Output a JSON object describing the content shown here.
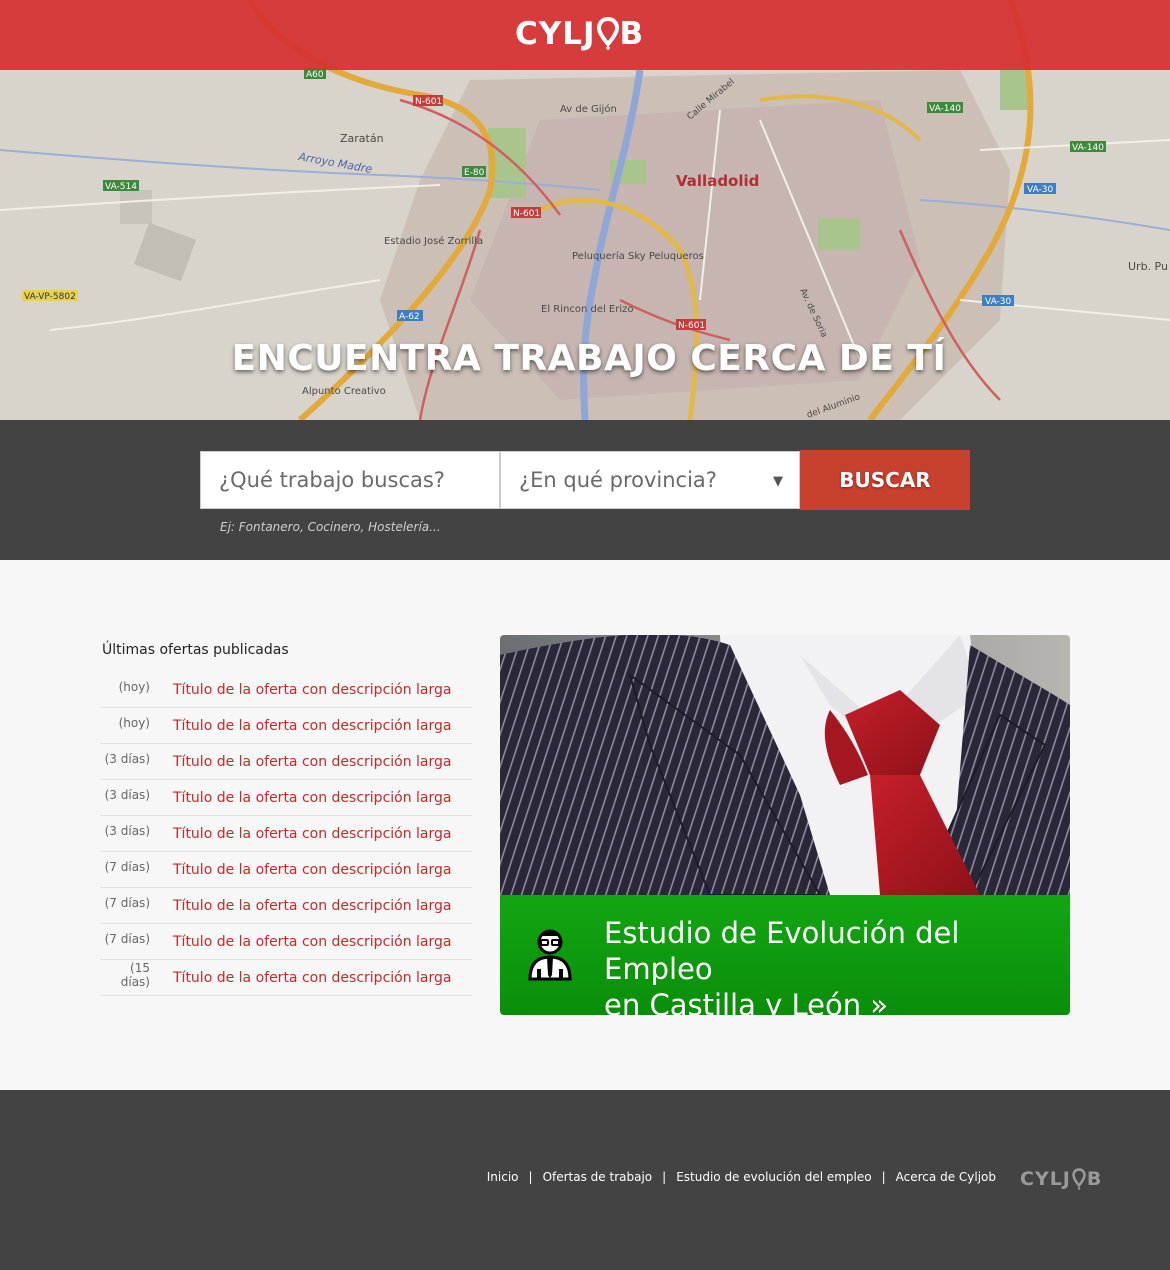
{
  "header": {
    "logo_left": "CYLJ",
    "logo_right": "B"
  },
  "hero": {
    "title": "ENCUENTRA TRABAJO CERCA DE TÍ",
    "map_labels": {
      "city": "Valladolid",
      "zaratan": "Zaratán",
      "arroyo": "Arroyo Madre",
      "estadio": "Estadio José Zorrilla",
      "peluqueria": "Peluquería Sky Peluqueros",
      "rincon": "El Rincon del Erizo",
      "alpunto": "Alpunto Creativo",
      "gijon": "Av de Gijón",
      "mirabel": "Calle Mirabel",
      "soria": "Av. de Soria",
      "urb": "Urb. Pu de Casa",
      "aluminio": "del Aluminio",
      "road_a60": "A60",
      "road_n601a": "N-601",
      "road_n601b": "N-601",
      "road_n601c": "N-601",
      "road_e80": "E-80",
      "road_va514": "VA-514",
      "road_va140a": "VA-140",
      "road_va140b": "VA-140",
      "road_va30a": "VA-30",
      "road_va30b": "VA-30",
      "road_vavp": "VA-VP-5802",
      "road_a62": "A-62"
    }
  },
  "search": {
    "job_placeholder": "¿Qué trabajo buscas?",
    "province_placeholder": "¿En qué provincia?",
    "button_label": "BUSCAR",
    "hint": "Ej: Fontanero, Cocinero, Hostelería..."
  },
  "latest": {
    "title": "Últimas ofertas publicadas",
    "offers": [
      {
        "age": "(hoy)",
        "title": "Título de la oferta con descripción larga"
      },
      {
        "age": "(hoy)",
        "title": "Título de la oferta con descripción larga"
      },
      {
        "age": "(3 días)",
        "title": "Título de la oferta con descripción larga"
      },
      {
        "age": "(3 días)",
        "title": "Título de la oferta con descripción larga"
      },
      {
        "age": "(3 días)",
        "title": "Título de la oferta con descripción larga"
      },
      {
        "age": "(7 días)",
        "title": "Título de la oferta con descripción larga"
      },
      {
        "age": "(7 días)",
        "title": "Título de la oferta con descripción larga"
      },
      {
        "age": "(7 días)",
        "title": "Título de la oferta con descripción larga"
      },
      {
        "age": "(15 días)",
        "title": "Título de la oferta con descripción larga"
      }
    ]
  },
  "promo": {
    "line1": "Estudio de Evolución del Empleo",
    "line2": "en Castilla y León »"
  },
  "footer": {
    "links": [
      "Inicio",
      "Ofertas de trabajo",
      "Estudio de evolución del empleo",
      "Acerca de Cyljob"
    ],
    "separator": "|",
    "logo_left": "CYLJ",
    "logo_right": "B"
  },
  "colors": {
    "brand_red": "#d63030",
    "button_red": "#c8402e",
    "promo_green": "#0f9e0f",
    "dark_band": "#434343",
    "link_red": "#c62828"
  }
}
